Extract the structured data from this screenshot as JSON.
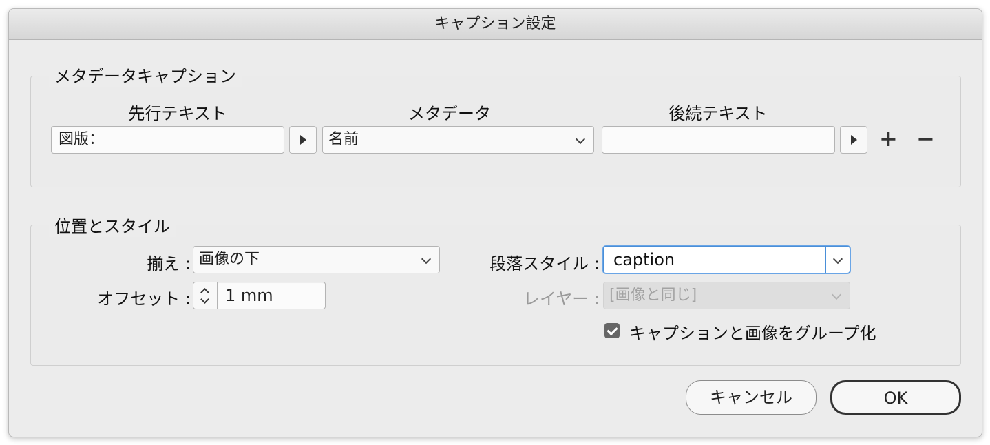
{
  "window": {
    "title": "キャプション設定"
  },
  "metadata_caption": {
    "group_label": "メタデータキャプション",
    "columns": {
      "leading_text": "先行テキスト",
      "metadata": "メタデータ",
      "trailing_text": "後続テキスト"
    },
    "leading_text_value": "図版：",
    "metadata_value": "名前",
    "trailing_text_value": "",
    "add_label": "+",
    "remove_label": "−"
  },
  "position_style": {
    "group_label": "位置とスタイル",
    "align_label": "揃え :",
    "align_value": "画像の下",
    "offset_label": "オフセット :",
    "offset_value": "1 mm",
    "paragraph_style_label": "段落スタイル :",
    "paragraph_style_value": "caption",
    "layer_label": "レイヤー :",
    "layer_value": "[画像と同じ]",
    "group_checkbox_label": "キャプションと画像をグループ化",
    "group_checkbox_checked": true
  },
  "buttons": {
    "cancel": "キャンセル",
    "ok": "OK"
  }
}
